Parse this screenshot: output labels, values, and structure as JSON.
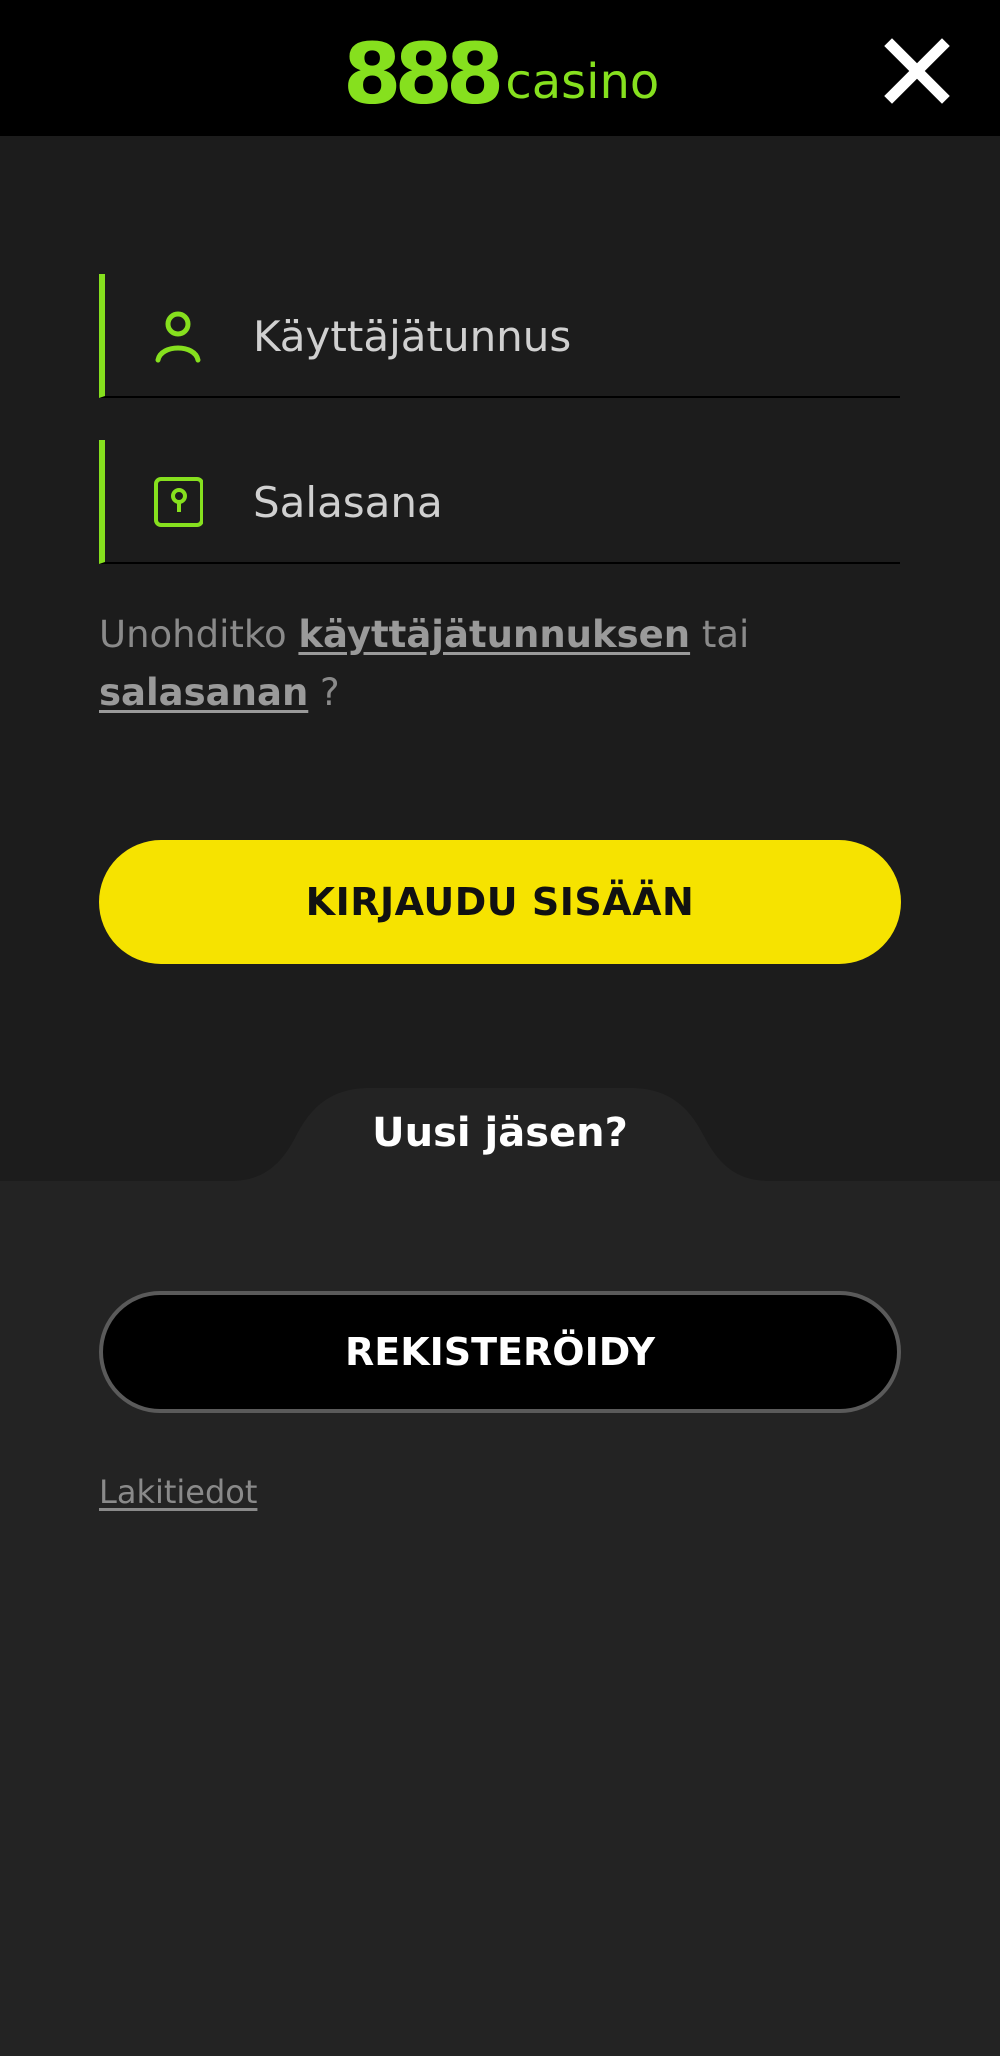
{
  "header": {
    "logo_number": "888",
    "logo_word": "casino",
    "close_icon": "close-icon"
  },
  "login_form": {
    "username_placeholder": "Käyttäjätunnus",
    "password_placeholder": "Salasana",
    "username_icon": "user-icon",
    "password_icon": "lock-icon",
    "forgot": {
      "prefix": "Unohditko",
      "username_link": "käyttäjätunnuksen",
      "middle": "tai",
      "password_link": "salasanan",
      "suffix": "?"
    },
    "login_button": "KIRJAUDU SISÄÄN"
  },
  "register_section": {
    "tab_label": "Uusi jäsen?",
    "register_button": "REKISTERÖIDY",
    "legal_link": "Lakitiedot"
  },
  "colors": {
    "brand_green": "#86e01e",
    "login_yellow": "#f6e300",
    "header_bg": "#000000",
    "upper_bg": "#1c1c1c",
    "lower_bg": "#232323"
  }
}
